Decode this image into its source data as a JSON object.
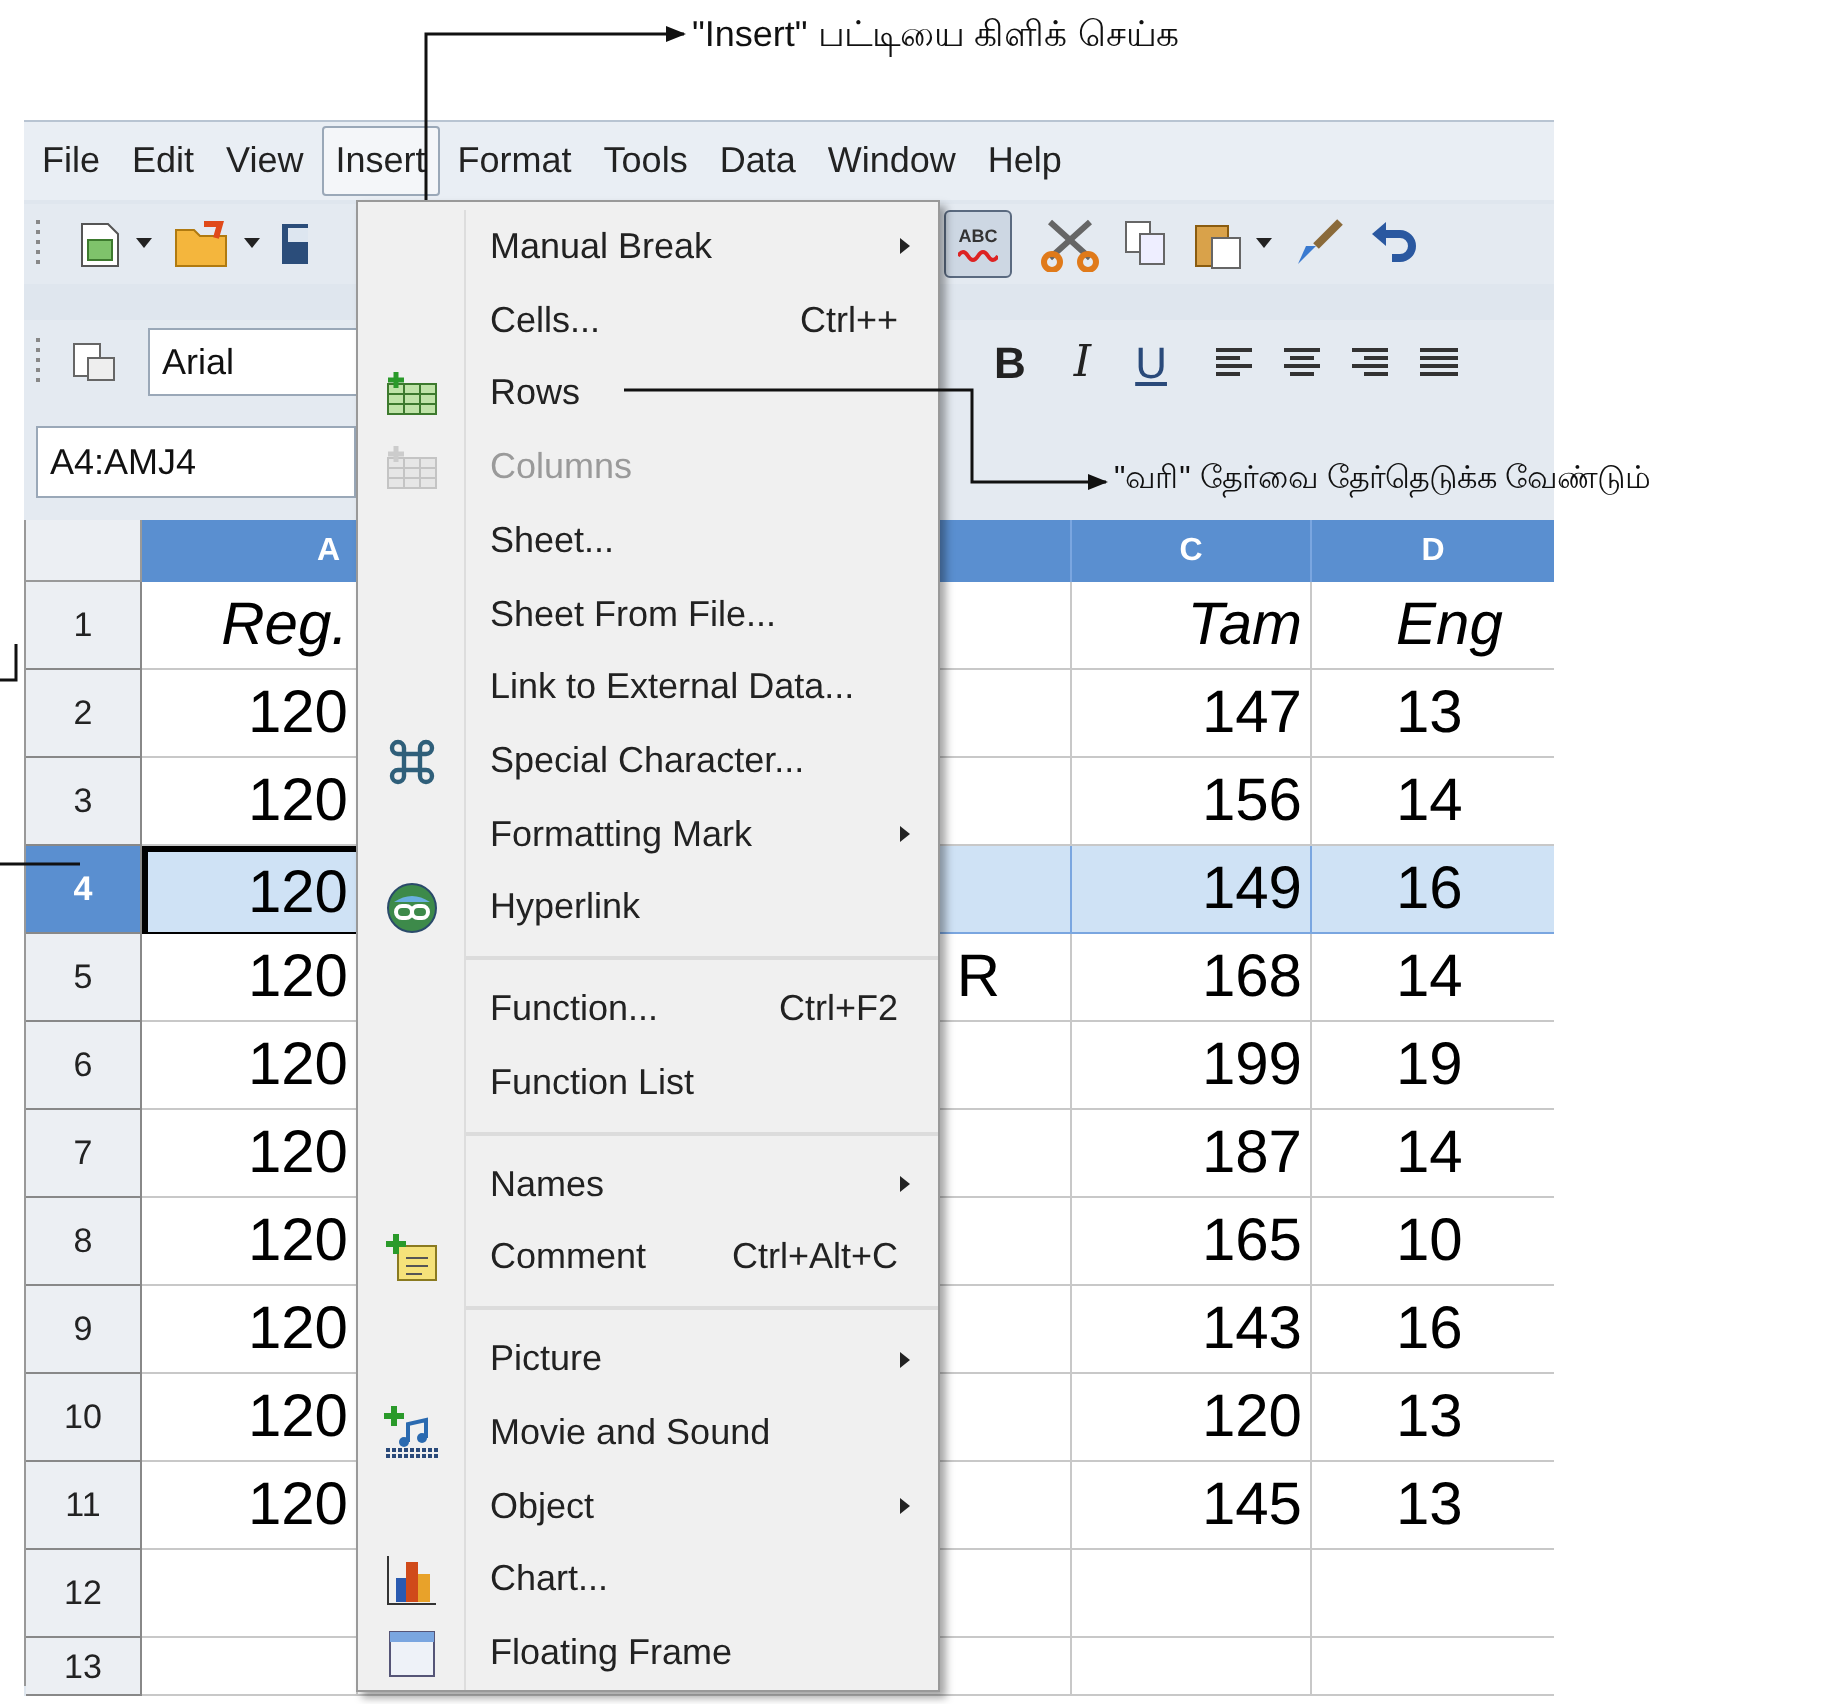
{
  "annotations": [
    {
      "text": "\"Insert\" பட்டியை கிளிக் செய்க"
    },
    {
      "text": "\"வரி\" தேர்வை தேர்தெடுக்க வேண்டும்"
    }
  ],
  "menubar": [
    {
      "label": "File",
      "selected": false
    },
    {
      "label": "Edit",
      "selected": false
    },
    {
      "label": "View",
      "selected": false
    },
    {
      "label": "Insert",
      "selected": true
    },
    {
      "label": "Format",
      "selected": false
    },
    {
      "label": "Tools",
      "selected": false
    },
    {
      "label": "Data",
      "selected": false
    },
    {
      "label": "Window",
      "selected": false
    },
    {
      "label": "Help",
      "selected": false
    }
  ],
  "toolbar": {
    "autospellcheck_on": true,
    "autospellcheck_label": "ABC",
    "font_name": "Arial",
    "format_buttons": [
      "B",
      "I",
      "U"
    ]
  },
  "name_box": {
    "value": "A4:AMJ4"
  },
  "insert_menu": [
    {
      "kind": "item",
      "label": "Manual Break",
      "submenu": true,
      "disabled": false
    },
    {
      "kind": "item",
      "label": "Cells...",
      "shortcut": "Ctrl++",
      "submenu": false,
      "disabled": false
    },
    {
      "kind": "item",
      "label": "Rows",
      "submenu": false,
      "disabled": false
    },
    {
      "kind": "item",
      "label": "Columns",
      "submenu": false,
      "disabled": true
    },
    {
      "kind": "item",
      "label": "Sheet...",
      "submenu": false,
      "disabled": false
    },
    {
      "kind": "item",
      "label": "Sheet From File...",
      "submenu": false,
      "disabled": false
    },
    {
      "kind": "item",
      "label": "Link to External Data...",
      "submenu": false,
      "disabled": false
    },
    {
      "kind": "item",
      "label": "Special Character...",
      "submenu": false,
      "disabled": false
    },
    {
      "kind": "item",
      "label": "Formatting Mark",
      "submenu": true,
      "disabled": false
    },
    {
      "kind": "item",
      "label": "Hyperlink",
      "submenu": false,
      "disabled": false
    },
    {
      "kind": "separator"
    },
    {
      "kind": "item",
      "label": "Function...",
      "shortcut": "Ctrl+F2",
      "submenu": false,
      "disabled": false
    },
    {
      "kind": "item",
      "label": "Function List",
      "submenu": false,
      "disabled": false
    },
    {
      "kind": "separator"
    },
    {
      "kind": "item",
      "label": "Names",
      "submenu": true,
      "disabled": false
    },
    {
      "kind": "item",
      "label": "Comment",
      "shortcut": "Ctrl+Alt+C",
      "submenu": false,
      "disabled": false
    },
    {
      "kind": "separator"
    },
    {
      "kind": "item",
      "label": "Picture",
      "submenu": true,
      "disabled": false
    },
    {
      "kind": "item",
      "label": "Movie and Sound",
      "submenu": false,
      "disabled": false
    },
    {
      "kind": "item",
      "label": "Object",
      "submenu": true,
      "disabled": false
    },
    {
      "kind": "item",
      "label": "Chart...",
      "submenu": false,
      "disabled": false
    },
    {
      "kind": "item",
      "label": "Floating Frame",
      "submenu": false,
      "disabled": false
    }
  ],
  "sheet": {
    "columns": [
      "A",
      "C",
      "D"
    ],
    "rows": [
      {
        "header": "1",
        "selected": false,
        "a": "Reg.",
        "c": "Tam",
        "d": "Eng"
      },
      {
        "header": "2",
        "selected": false,
        "a": "120",
        "c": "147",
        "d": "13"
      },
      {
        "header": "3",
        "selected": false,
        "a": "120",
        "c": "156",
        "d": "14"
      },
      {
        "header": "4",
        "selected": true,
        "a": "120",
        "c": "149",
        "d": "16"
      },
      {
        "header": "5",
        "selected": false,
        "a": "120",
        "b": "R",
        "c": "168",
        "d": "14"
      },
      {
        "header": "6",
        "selected": false,
        "a": "120",
        "c": "199",
        "d": "19"
      },
      {
        "header": "7",
        "selected": false,
        "a": "120",
        "c": "187",
        "d": "14"
      },
      {
        "header": "8",
        "selected": false,
        "a": "120",
        "c": "165",
        "d": "10"
      },
      {
        "header": "9",
        "selected": false,
        "a": "120",
        "c": "143",
        "d": "16"
      },
      {
        "header": "10",
        "selected": false,
        "a": "120",
        "c": "120",
        "d": "13"
      },
      {
        "header": "11",
        "selected": false,
        "a": "120",
        "c": "145",
        "d": "13"
      },
      {
        "header": "12",
        "selected": false
      },
      {
        "header": "13",
        "selected": false
      }
    ]
  }
}
